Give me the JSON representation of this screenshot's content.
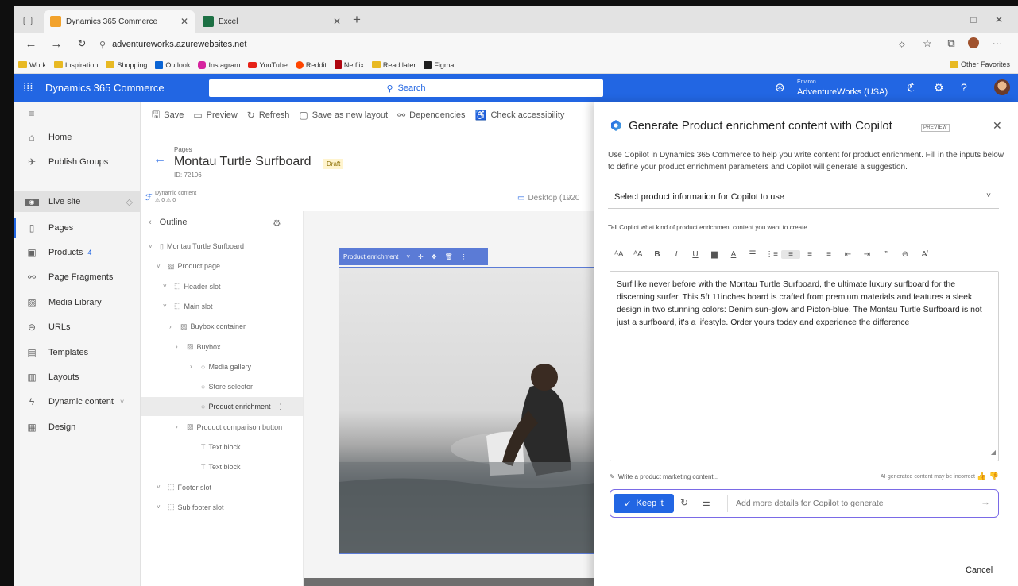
{
  "browser": {
    "tabs": [
      {
        "title": "Dynamics 365 Commerce",
        "color": "#f2a22c"
      },
      {
        "title": "Excel",
        "color": "#1d7044"
      }
    ],
    "url": "adventureworks.azurewebsites.net",
    "bookmarks": [
      {
        "label": "Work",
        "color": "#e8b923"
      },
      {
        "label": "Inspiration",
        "color": "#e8b923"
      },
      {
        "label": "Shopping",
        "color": "#e8b923"
      },
      {
        "label": "Outlook",
        "color": "#0a64d4"
      },
      {
        "label": "Instagram",
        "color": "#d6249f"
      },
      {
        "label": "YouTube",
        "color": "#e62117"
      },
      {
        "label": "Reddit",
        "color": "#ff4500"
      },
      {
        "label": "Netflix",
        "color": "#b00610"
      },
      {
        "label": "Read later",
        "color": "#e8b923"
      },
      {
        "label": "Figma",
        "color": "#1e1e1e"
      }
    ],
    "other_favorites": "Other Favorites"
  },
  "app": {
    "name": "Dynamics 365 Commerce",
    "search_label": "Search",
    "env_caption": "Environ",
    "env_name": "AdventureWorks (USA)",
    "accent": "#2266e3"
  },
  "nav": {
    "items": [
      {
        "label": "Home",
        "icon": "home-icon",
        "glyph": "⌂"
      },
      {
        "label": "Publish Groups",
        "icon": "rocket-icon",
        "glyph": "✈"
      },
      {
        "label": "Live site",
        "icon": "globe-icon",
        "glyph": "◉"
      },
      {
        "label": "Pages",
        "icon": "page-icon",
        "glyph": "▯"
      },
      {
        "label": "Products",
        "icon": "box-icon",
        "glyph": "▣",
        "badge": "4"
      },
      {
        "label": "Page Fragments",
        "icon": "fragments-icon",
        "glyph": "⚯"
      },
      {
        "label": "Media Library",
        "icon": "image-icon",
        "glyph": "▨"
      },
      {
        "label": "URLs",
        "icon": "link-icon",
        "glyph": "⊖"
      },
      {
        "label": "Templates",
        "icon": "template-icon",
        "glyph": "▤"
      },
      {
        "label": "Layouts",
        "icon": "layout-icon",
        "glyph": "▥"
      },
      {
        "label": "Dynamic content",
        "icon": "lightning-icon",
        "glyph": "ϟ"
      },
      {
        "label": "Design",
        "icon": "palette-icon",
        "glyph": "▦"
      }
    ]
  },
  "toolbar": {
    "save": "Save",
    "preview": "Preview",
    "refresh": "Refresh",
    "save_layout": "Save as new layout",
    "dependencies": "Dependencies",
    "check_access": "Check accessibility"
  },
  "page": {
    "crumb": "Pages",
    "title": "Montau Turtle Surfboard",
    "status": "Draft",
    "id": "ID: 72106",
    "dynamic_label": "Dynamic content",
    "dynamic_counts": "⚠ 0   ⚠ 0",
    "desktop_label": "Desktop (1920"
  },
  "outline": {
    "header": "Outline",
    "items": [
      {
        "label": "Montau Turtle Surfboard",
        "chev": "˅",
        "icon": "▯"
      },
      {
        "label": "Product page",
        "chev": "˅",
        "icon": "▨"
      },
      {
        "label": "Header slot",
        "chev": "˅",
        "icon": "⬚"
      },
      {
        "label": "Main slot",
        "chev": "˅",
        "icon": "⬚"
      },
      {
        "label": "Buybox container",
        "chev": "›",
        "icon": "▨"
      },
      {
        "label": "Buybox",
        "chev": "›",
        "icon": "▨"
      },
      {
        "label": "Media gallery",
        "chev": "›",
        "icon": "○"
      },
      {
        "label": "Store selector",
        "chev": "",
        "icon": "○"
      },
      {
        "label": "Product enrichment",
        "chev": "",
        "icon": "○"
      },
      {
        "label": "Product comparison button",
        "chev": "›",
        "icon": "▨"
      },
      {
        "label": "Text block",
        "chev": "",
        "icon": "T"
      },
      {
        "label": "Text block",
        "chev": "",
        "icon": "T"
      },
      {
        "label": "Footer slot",
        "chev": "˅",
        "icon": "⬚"
      },
      {
        "label": "Sub footer slot",
        "chev": "˅",
        "icon": "⬚"
      }
    ]
  },
  "canvas": {
    "module_label": "Product enrichment"
  },
  "copilot": {
    "title": "Generate Product enrichment content with Copilot",
    "preview_tag": "PREVIEW",
    "description": "Use Copilot in Dynamics 365 Commerce to help you write content for product enrichment. Fill in the inputs below to define your product enrichment parameters and Copilot will generate a suggestion.",
    "select_label": "Select product information for Copilot to use",
    "tell_label": "Tell Copilot what kind of product enrichment content you want to create",
    "content": "Surf like never before with the Montau Turtle Surfboard, the ultimate luxury surfboard for the discerning surfer. This 5ft 11inches board is crafted from premium materials and features a sleek design in two stunning colors: Denim sun-glow and Picton-blue. The Montau Turtle Surfboard is not just a surfboard, it's a lifestyle. Order yours today and experience the difference",
    "prompt_used": "Write a product marketing content...",
    "disclaimer": "AI-generated content may be incorrect",
    "keep_label": "Keep it",
    "details_placeholder": "Add more details for Copilot to generate",
    "cancel_label": "Cancel"
  }
}
